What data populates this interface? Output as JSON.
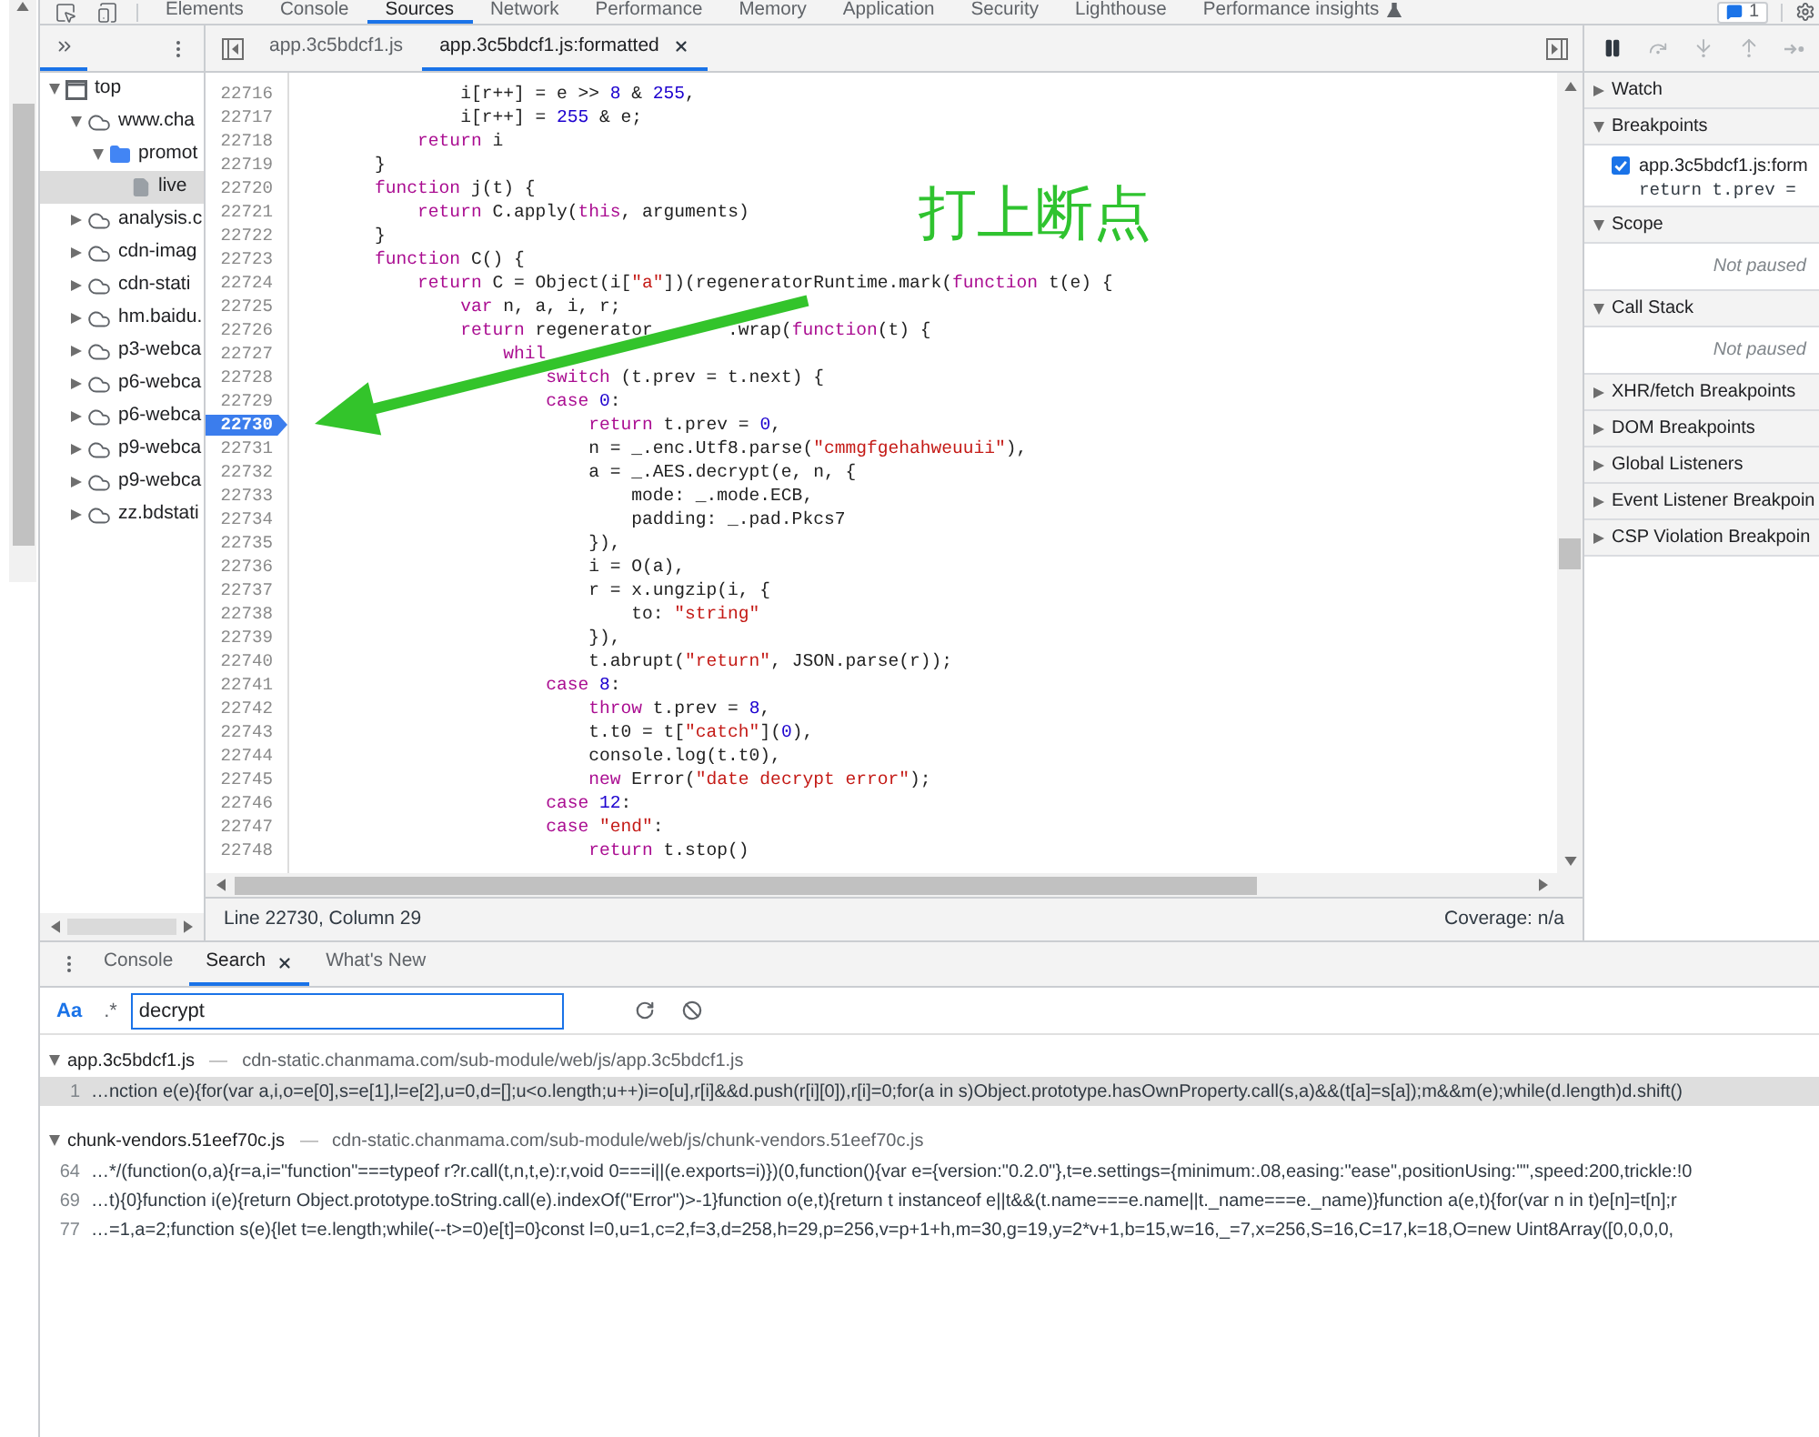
{
  "devtools_tabs": [
    {
      "label": "Elements",
      "kind": "panel",
      "selected": false
    },
    {
      "label": "Console",
      "kind": "panel",
      "selected": false
    },
    {
      "label": "Sources",
      "kind": "panel",
      "selected": true
    },
    {
      "label": "Network",
      "kind": "panel",
      "selected": false
    },
    {
      "label": "Performance",
      "kind": "panel",
      "selected": false
    },
    {
      "label": "Memory",
      "kind": "panel",
      "selected": false
    },
    {
      "label": "Application",
      "kind": "panel",
      "selected": false
    },
    {
      "label": "Security",
      "kind": "panel",
      "selected": false
    },
    {
      "label": "Lighthouse",
      "kind": "panel",
      "selected": false
    },
    {
      "label": "Performance insights",
      "kind": "experiment",
      "selected": false
    }
  ],
  "issues_badge": {
    "count": "1"
  },
  "navigator": {
    "tree": [
      {
        "label": "top",
        "kind": "frame",
        "expanded": true,
        "selected": false,
        "children": [
          {
            "label": "www.cha",
            "kind": "domain",
            "expanded": true,
            "selected": false,
            "children": [
              {
                "label": "promot",
                "kind": "folder",
                "expanded": true,
                "selected": false,
                "children": [
                  {
                    "label": "live",
                    "kind": "file",
                    "selected": true
                  }
                ]
              }
            ]
          },
          {
            "label": "analysis.c",
            "kind": "domain",
            "expanded": false,
            "selected": false
          },
          {
            "label": "cdn-imag",
            "kind": "domain",
            "expanded": false,
            "selected": false
          },
          {
            "label": "cdn-stati",
            "kind": "domain",
            "expanded": false,
            "selected": false
          },
          {
            "label": "hm.baidu.",
            "kind": "domain",
            "expanded": false,
            "selected": false
          },
          {
            "label": "p3-webca",
            "kind": "domain",
            "expanded": false,
            "selected": false
          },
          {
            "label": "p6-webca",
            "kind": "domain",
            "expanded": false,
            "selected": false
          },
          {
            "label": "p6-webca",
            "kind": "domain",
            "expanded": false,
            "selected": false
          },
          {
            "label": "p9-webca",
            "kind": "domain",
            "expanded": false,
            "selected": false
          },
          {
            "label": "p9-webca",
            "kind": "domain",
            "expanded": false,
            "selected": false
          },
          {
            "label": "zz.bdstati",
            "kind": "domain",
            "expanded": false,
            "selected": false
          }
        ]
      }
    ]
  },
  "editor": {
    "tabs": [
      {
        "label": "app.3c5bdcf1.js",
        "selected": false,
        "closable": false
      },
      {
        "label": "app.3c5bdcf1.js:formatted",
        "selected": true,
        "closable": true
      }
    ],
    "lines": [
      {
        "number": "22716",
        "breakpoint": false,
        "tokens": [
          {
            "kind": "plain",
            "text": "                i[r++] = e >> "
          },
          {
            "kind": "number",
            "text": "8"
          },
          {
            "kind": "plain",
            "text": " & "
          },
          {
            "kind": "number",
            "text": "255"
          },
          {
            "kind": "plain",
            "text": ","
          }
        ]
      },
      {
        "number": "22717",
        "breakpoint": false,
        "tokens": [
          {
            "kind": "plain",
            "text": "                i[r++] = "
          },
          {
            "kind": "number",
            "text": "255"
          },
          {
            "kind": "plain",
            "text": " & e;"
          }
        ]
      },
      {
        "number": "22718",
        "breakpoint": false,
        "tokens": [
          {
            "kind": "keyword",
            "text": "            return"
          },
          {
            "kind": "plain",
            "text": " i"
          }
        ]
      },
      {
        "number": "22719",
        "breakpoint": false,
        "tokens": [
          {
            "kind": "plain",
            "text": "        }"
          }
        ]
      },
      {
        "number": "22720",
        "breakpoint": false,
        "tokens": [
          {
            "kind": "keyword",
            "text": "        function"
          },
          {
            "kind": "plain",
            "text": " j(t) {"
          }
        ]
      },
      {
        "number": "22721",
        "breakpoint": false,
        "tokens": [
          {
            "kind": "keyword",
            "text": "            return"
          },
          {
            "kind": "plain",
            "text": " C.apply("
          },
          {
            "kind": "keyword",
            "text": "this"
          },
          {
            "kind": "plain",
            "text": ", arguments)"
          }
        ]
      },
      {
        "number": "22722",
        "breakpoint": false,
        "tokens": [
          {
            "kind": "plain",
            "text": "        }"
          }
        ]
      },
      {
        "number": "22723",
        "breakpoint": false,
        "tokens": [
          {
            "kind": "keyword",
            "text": "        function"
          },
          {
            "kind": "plain",
            "text": " C() {"
          }
        ]
      },
      {
        "number": "22724",
        "breakpoint": false,
        "tokens": [
          {
            "kind": "keyword",
            "text": "            return"
          },
          {
            "kind": "plain",
            "text": " C = Object(i["
          },
          {
            "kind": "string",
            "text": "\"a\""
          },
          {
            "kind": "plain",
            "text": "])(regeneratorRuntime.mark("
          },
          {
            "kind": "keyword",
            "text": "function"
          },
          {
            "kind": "plain",
            "text": " t(e) {"
          }
        ]
      },
      {
        "number": "22725",
        "breakpoint": false,
        "tokens": [
          {
            "kind": "keyword",
            "text": "                var"
          },
          {
            "kind": "plain",
            "text": " n, a, i, r;"
          }
        ]
      },
      {
        "number": "22726",
        "breakpoint": false,
        "tokens": [
          {
            "kind": "keyword",
            "text": "                return"
          },
          {
            "kind": "plain",
            "text": " regenerator       .wrap("
          },
          {
            "kind": "keyword",
            "text": "function"
          },
          {
            "kind": "plain",
            "text": "(t) {"
          }
        ]
      },
      {
        "number": "22727",
        "breakpoint": false,
        "tokens": [
          {
            "kind": "keyword",
            "text": "                    whil"
          }
        ]
      },
      {
        "number": "22728",
        "breakpoint": false,
        "tokens": [
          {
            "kind": "keyword",
            "text": "                        switch"
          },
          {
            "kind": "plain",
            "text": " (t.prev = t.next) {"
          }
        ]
      },
      {
        "number": "22729",
        "breakpoint": false,
        "tokens": [
          {
            "kind": "keyword",
            "text": "                        case "
          },
          {
            "kind": "number",
            "text": "0"
          },
          {
            "kind": "plain",
            "text": ":"
          }
        ]
      },
      {
        "number": "22730",
        "breakpoint": true,
        "tokens": [
          {
            "kind": "keyword",
            "text": "                            return"
          },
          {
            "kind": "plain",
            "text": " t.prev = "
          },
          {
            "kind": "number",
            "text": "0"
          },
          {
            "kind": "plain",
            "text": ","
          }
        ]
      },
      {
        "number": "22731",
        "breakpoint": false,
        "tokens": [
          {
            "kind": "plain",
            "text": "                            n = _.enc.Utf8.parse("
          },
          {
            "kind": "string",
            "text": "\"cmmgfgehahweuuii\""
          },
          {
            "kind": "plain",
            "text": "),"
          }
        ]
      },
      {
        "number": "22732",
        "breakpoint": false,
        "tokens": [
          {
            "kind": "plain",
            "text": "                            a = _.AES.decrypt(e, n, {"
          }
        ]
      },
      {
        "number": "22733",
        "breakpoint": false,
        "tokens": [
          {
            "kind": "plain",
            "text": "                                mode: _.mode.ECB,"
          }
        ]
      },
      {
        "number": "22734",
        "breakpoint": false,
        "tokens": [
          {
            "kind": "plain",
            "text": "                                padding: _.pad.Pkcs7"
          }
        ]
      },
      {
        "number": "22735",
        "breakpoint": false,
        "tokens": [
          {
            "kind": "plain",
            "text": "                            }),"
          }
        ]
      },
      {
        "number": "22736",
        "breakpoint": false,
        "tokens": [
          {
            "kind": "plain",
            "text": "                            i = O(a),"
          }
        ]
      },
      {
        "number": "22737",
        "breakpoint": false,
        "tokens": [
          {
            "kind": "plain",
            "text": "                            r = x.ungzip(i, {"
          }
        ]
      },
      {
        "number": "22738",
        "breakpoint": false,
        "tokens": [
          {
            "kind": "plain",
            "text": "                                to: "
          },
          {
            "kind": "string",
            "text": "\"string\""
          }
        ]
      },
      {
        "number": "22739",
        "breakpoint": false,
        "tokens": [
          {
            "kind": "plain",
            "text": "                            }),"
          }
        ]
      },
      {
        "number": "22740",
        "breakpoint": false,
        "tokens": [
          {
            "kind": "plain",
            "text": "                            t.abrupt("
          },
          {
            "kind": "string",
            "text": "\"return\""
          },
          {
            "kind": "plain",
            "text": ", JSON.parse(r));"
          }
        ]
      },
      {
        "number": "22741",
        "breakpoint": false,
        "tokens": [
          {
            "kind": "keyword",
            "text": "                        case "
          },
          {
            "kind": "number",
            "text": "8"
          },
          {
            "kind": "plain",
            "text": ":"
          }
        ]
      },
      {
        "number": "22742",
        "breakpoint": false,
        "tokens": [
          {
            "kind": "keyword",
            "text": "                            throw"
          },
          {
            "kind": "plain",
            "text": " t.prev = "
          },
          {
            "kind": "number",
            "text": "8"
          },
          {
            "kind": "plain",
            "text": ","
          }
        ]
      },
      {
        "number": "22743",
        "breakpoint": false,
        "tokens": [
          {
            "kind": "plain",
            "text": "                            t.t0 = t["
          },
          {
            "kind": "string",
            "text": "\"catch\""
          },
          {
            "kind": "plain",
            "text": "]("
          },
          {
            "kind": "number",
            "text": "0"
          },
          {
            "kind": "plain",
            "text": "),"
          }
        ]
      },
      {
        "number": "22744",
        "breakpoint": false,
        "tokens": [
          {
            "kind": "plain",
            "text": "                            console.log(t.t0),"
          }
        ]
      },
      {
        "number": "22745",
        "breakpoint": false,
        "tokens": [
          {
            "kind": "keyword",
            "text": "                            new"
          },
          {
            "kind": "plain",
            "text": " Error("
          },
          {
            "kind": "string",
            "text": "\"date decrypt error\""
          },
          {
            "kind": "plain",
            "text": ");"
          }
        ]
      },
      {
        "number": "22746",
        "breakpoint": false,
        "tokens": [
          {
            "kind": "keyword",
            "text": "                        case "
          },
          {
            "kind": "number",
            "text": "12"
          },
          {
            "kind": "plain",
            "text": ":"
          }
        ]
      },
      {
        "number": "22747",
        "breakpoint": false,
        "tokens": [
          {
            "kind": "keyword",
            "text": "                        case "
          },
          {
            "kind": "string",
            "text": "\"end\""
          },
          {
            "kind": "plain",
            "text": ":"
          }
        ]
      },
      {
        "number": "22748",
        "breakpoint": false,
        "tokens": [
          {
            "kind": "keyword",
            "text": "                            return"
          },
          {
            "kind": "plain",
            "text": " t.stop()"
          }
        ]
      }
    ],
    "status": {
      "position": "Line 22730, Column 29",
      "coverage": "Coverage: n/a"
    }
  },
  "annotation": {
    "text": "打上断点"
  },
  "debugger": {
    "controls": [
      {
        "kind": "pause",
        "disabled": false
      },
      {
        "kind": "step_over",
        "disabled": true
      },
      {
        "kind": "step_into",
        "disabled": true
      },
      {
        "kind": "step_out",
        "disabled": true
      },
      {
        "kind": "step",
        "disabled": true
      }
    ],
    "sections": [
      {
        "title": "Watch",
        "expanded": false
      },
      {
        "title": "Breakpoints",
        "expanded": true,
        "breakpoints": [
          {
            "file": "app.3c5bdcf1.js:form",
            "code": "return t.prev =",
            "checked": true
          }
        ]
      },
      {
        "title": "Scope",
        "expanded": true,
        "message": "Not paused"
      },
      {
        "title": "Call Stack",
        "expanded": true,
        "message": "Not paused"
      },
      {
        "title": "XHR/fetch Breakpoints",
        "expanded": false
      },
      {
        "title": "DOM Breakpoints",
        "expanded": false
      },
      {
        "title": "Global Listeners",
        "expanded": false
      },
      {
        "title": "Event Listener Breakpoin",
        "expanded": false
      },
      {
        "title": "CSP Violation Breakpoin",
        "expanded": false
      }
    ]
  },
  "drawer": {
    "tabs": [
      {
        "label": "Console",
        "selected": false,
        "closable": false
      },
      {
        "label": "Search",
        "selected": true,
        "closable": true
      },
      {
        "label": "What's New",
        "selected": false,
        "closable": false
      }
    ],
    "search": {
      "options": [
        {
          "label": "Aa",
          "on": true
        },
        {
          "label": ".*",
          "on": false
        }
      ],
      "query": "decrypt"
    },
    "results": [
      {
        "file": "app.3c5bdcf1.js",
        "path": "cdn-static.chanmama.com/sub-module/web/js/app.3c5bdcf1.js",
        "expanded": true,
        "matches": [
          {
            "line": "1",
            "text": "…nction e(e){for(var a,i,o=e[0],s=e[1],l=e[2],u=0,d=[];u<o.length;u++)i=o[u],r[i]&&d.push(r[i][0]),r[i]=0;for(a in s)Object.prototype.hasOwnProperty.call(s,a)&&(t[a]=s[a]);m&&m(e);while(d.length)d.shift()",
            "selected": true
          }
        ]
      },
      {
        "file": "chunk-vendors.51eef70c.js",
        "path": "cdn-static.chanmama.com/sub-module/web/js/chunk-vendors.51eef70c.js",
        "expanded": true,
        "matches": [
          {
            "line": "64",
            "text": "…*/(function(o,a){r=a,i=\"function\"===typeof r?r.call(t,n,t,e):r,void 0===i||(e.exports=i)})(0,function(){var e={version:\"0.2.0\"},t=e.settings={minimum:.08,easing:\"ease\",positionUsing:\"\",speed:200,trickle:!0",
            "selected": false
          },
          {
            "line": "69",
            "text": "…t){0}function i(e){return Object.prototype.toString.call(e).indexOf(\"Error\")>-1}function o(e,t){return t instanceof e||t&&(t.name===e.name||t._name===e._name)}function a(e,t){for(var n in t)e[n]=t[n];r",
            "selected": false
          },
          {
            "line": "77",
            "text": "…=1,a=2;function s(e){let t=e.length;while(--t>=0)e[t]=0}const l=0,u=1,c=2,f=3,d=258,h=29,p=256,v=p+1+h,m=30,g=19,y=2*v+1,b=15,w=16,_=7,x=256,S=16,C=17,k=18,O=new Uint8Array([0,0,0,0,",
            "selected": false
          }
        ]
      }
    ]
  }
}
